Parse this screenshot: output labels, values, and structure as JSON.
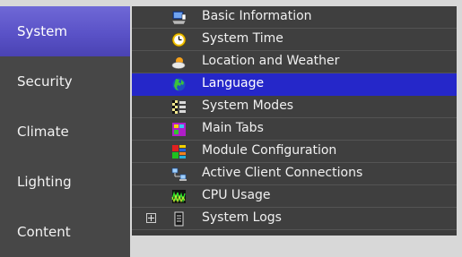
{
  "sidebar": {
    "items": [
      {
        "label": "System",
        "selected": true
      },
      {
        "label": "Security",
        "selected": false
      },
      {
        "label": "Climate",
        "selected": false
      },
      {
        "label": "Lighting",
        "selected": false
      },
      {
        "label": "Content",
        "selected": false
      }
    ]
  },
  "list": {
    "items": [
      {
        "label": "Basic Information",
        "icon": "computer-icon"
      },
      {
        "label": "System Time",
        "icon": "clock-icon"
      },
      {
        "label": "Location and Weather",
        "icon": "weather-icon"
      },
      {
        "label": "Language",
        "icon": "globe-icon",
        "selected": true
      },
      {
        "label": "System Modes",
        "icon": "modes-icon"
      },
      {
        "label": "Main Tabs",
        "icon": "tabs-icon"
      },
      {
        "label": "Module Configuration",
        "icon": "module-config-icon"
      },
      {
        "label": "Active Client Connections",
        "icon": "network-icon"
      },
      {
        "label": "CPU Usage",
        "icon": "cpu-usage-icon"
      },
      {
        "label": "System Logs",
        "icon": "log-icon",
        "expandable": true
      }
    ]
  },
  "colors": {
    "sidebar_bg": "#474747",
    "sidebar_selected": "#5a52c7",
    "list_bg": "#3f3f3f",
    "list_selected": "#2527c9"
  }
}
